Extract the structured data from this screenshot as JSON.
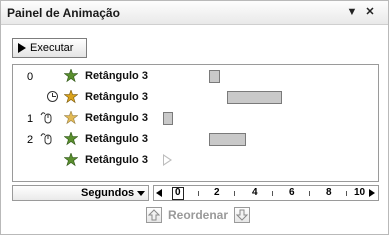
{
  "window": {
    "title": "Painel de Animação"
  },
  "toolbar": {
    "run_label": "Executar"
  },
  "effects": [
    {
      "order": "0",
      "trigger": "",
      "name": "Retângulo 3",
      "type": "entrance",
      "timing": "box"
    },
    {
      "order": "",
      "trigger": "after-previous",
      "name": "Retângulo 3",
      "type": "emphasis",
      "timing": "bar"
    },
    {
      "order": "1",
      "trigger": "on-click",
      "name": "Retângulo 3",
      "type": "exit",
      "timing": "box"
    },
    {
      "order": "2",
      "trigger": "on-click",
      "name": "Retângulo 3",
      "type": "entrance",
      "timing": "bar"
    },
    {
      "order": "",
      "trigger": "",
      "name": "Retângulo 3",
      "type": "entrance",
      "timing": "triangle"
    }
  ],
  "timeline": {
    "units_label": "Segundos",
    "ticks": [
      "0",
      "2",
      "4",
      "6",
      "8",
      "10"
    ]
  },
  "reorder": {
    "label": "Reordenar"
  },
  "colors": {
    "star_green": "#5a8f2e",
    "star_yellow": "#d9a21b",
    "bar_fill": "#c9c9c9"
  }
}
